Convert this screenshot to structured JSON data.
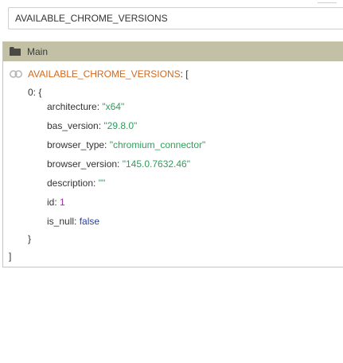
{
  "search": {
    "value": "AVAILABLE_CHROME_VERSIONS"
  },
  "panel": {
    "title": "Main",
    "icons": {
      "header": "folder-icon",
      "row": "link-icon"
    },
    "colors": {
      "header_bg": "#c3c1a5",
      "key_highlight": "#d2691e",
      "string_value": "#2e9e5b",
      "number_value": "#a22fb0",
      "boolean_value": "#2a3f9e"
    }
  },
  "tree": {
    "root_key": "AVAILABLE_CHROME_VERSIONS",
    "root_open": ": [",
    "item_open": "0: {",
    "fields": [
      {
        "key": "architecture",
        "sep": ": ",
        "value": "\"x64\"",
        "kind": "str"
      },
      {
        "key": "bas_version",
        "sep": ": ",
        "value": "\"29.8.0\"",
        "kind": "str"
      },
      {
        "key": "browser_type",
        "sep": ": ",
        "value": "\"chromium_connector\"",
        "kind": "str"
      },
      {
        "key": "browser_version",
        "sep": ": ",
        "value": "\"145.0.7632.46\"",
        "kind": "str"
      },
      {
        "key": "description",
        "sep": ": ",
        "value": "\"\"",
        "kind": "str"
      },
      {
        "key": "id",
        "sep": ": ",
        "value": "1",
        "kind": "num"
      },
      {
        "key": "is_null",
        "sep": ": ",
        "value": "false",
        "kind": "bool"
      }
    ],
    "item_close": "}",
    "root_close": "]"
  }
}
